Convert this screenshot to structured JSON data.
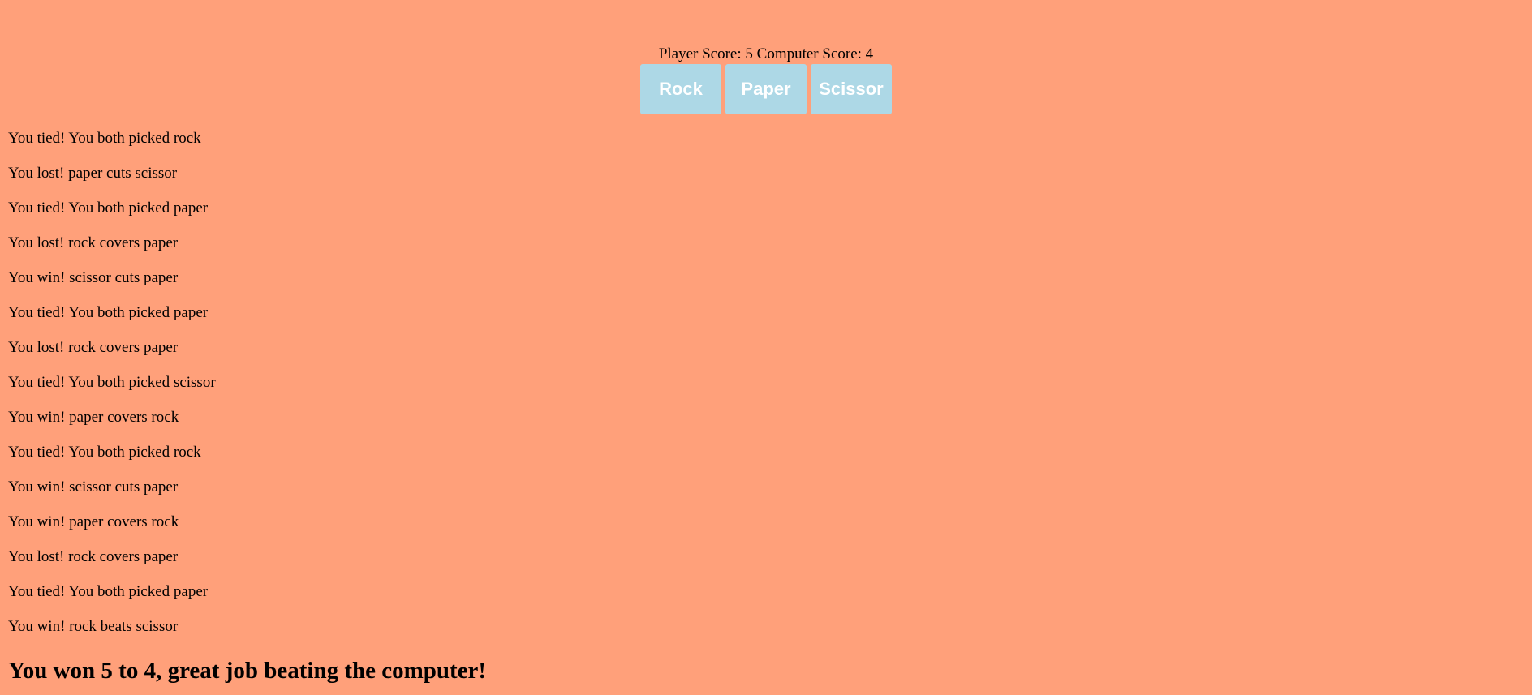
{
  "scoreboard": {
    "text": "Player Score: 5 Computer Score: 4"
  },
  "buttons": {
    "rock": "Rock",
    "paper": "Paper",
    "scissor": "Scissor"
  },
  "log": [
    "You tied! You both picked rock",
    "You lost! paper cuts scissor",
    "You tied! You both picked paper",
    "You lost! rock covers paper",
    "You win! scissor cuts paper",
    "You tied! You both picked paper",
    "You lost! rock covers paper",
    "You tied! You both picked scissor",
    "You win! paper covers rock",
    "You tied! You both picked rock",
    "You win! scissor cuts paper",
    "You win! paper covers rock",
    "You lost! rock covers paper",
    "You tied! You both picked paper",
    "You win! rock beats scissor"
  ],
  "final_message": "You won 5 to 4, great job beating the computer!",
  "colors": {
    "background": "#FFA07A",
    "button": "#ADD8E6",
    "button_text": "#FFFFFF"
  }
}
